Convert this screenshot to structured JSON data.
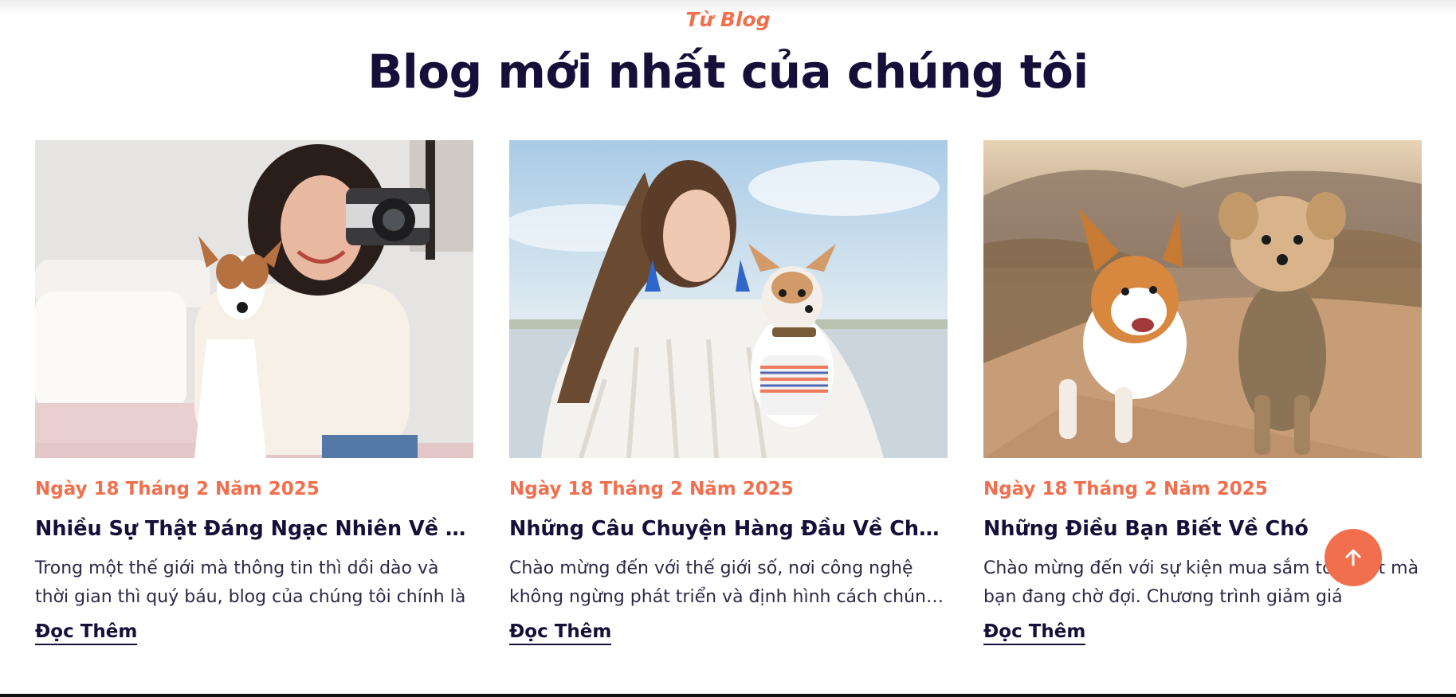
{
  "section": {
    "eyebrow": "Từ Blog",
    "heading": "Blog mới nhất của chúng tôi"
  },
  "posts": [
    {
      "image_icon": "woman-with-camera-and-dog-photo",
      "date": "Ngày 18 Tháng 2 Năm 2025",
      "title": "Nhiều Sự Thật Đáng Ngạc Nhiên Về Chó",
      "excerpt": "Trong một thế giới mà thông tin thì dồi dào và thời gian thì quý báu, blog của chúng tôi chính là",
      "read_more": "Đọc Thêm"
    },
    {
      "image_icon": "woman-holding-chihuahua-photo",
      "date": "Ngày 18 Tháng 2 Năm 2025",
      "title": "Những Câu Chuyện Hàng Đầu Về Chú Chó",
      "excerpt": "Chào mừng đến với thế giới số, nơi công nghệ không ngừng phát triển và định hình cách chúng ta",
      "read_more": "Đọc Thêm"
    },
    {
      "image_icon": "corgi-and-terrier-running-photo",
      "date": "Ngày 18 Tháng 2 Năm 2025",
      "title": "Những Điều Bạn Biết Về Chó",
      "excerpt": "Chào mừng đến với sự kiện mua sắm tốt nhất mà bạn đang chờ đợi. Chương trình giảm giá",
      "read_more": "Đọc Thêm"
    }
  ],
  "scroll_top": {
    "icon": "arrow-up-icon"
  },
  "colors": {
    "accent": "#f26f4e",
    "heading": "#160f3a",
    "body_text": "#2d2846"
  }
}
